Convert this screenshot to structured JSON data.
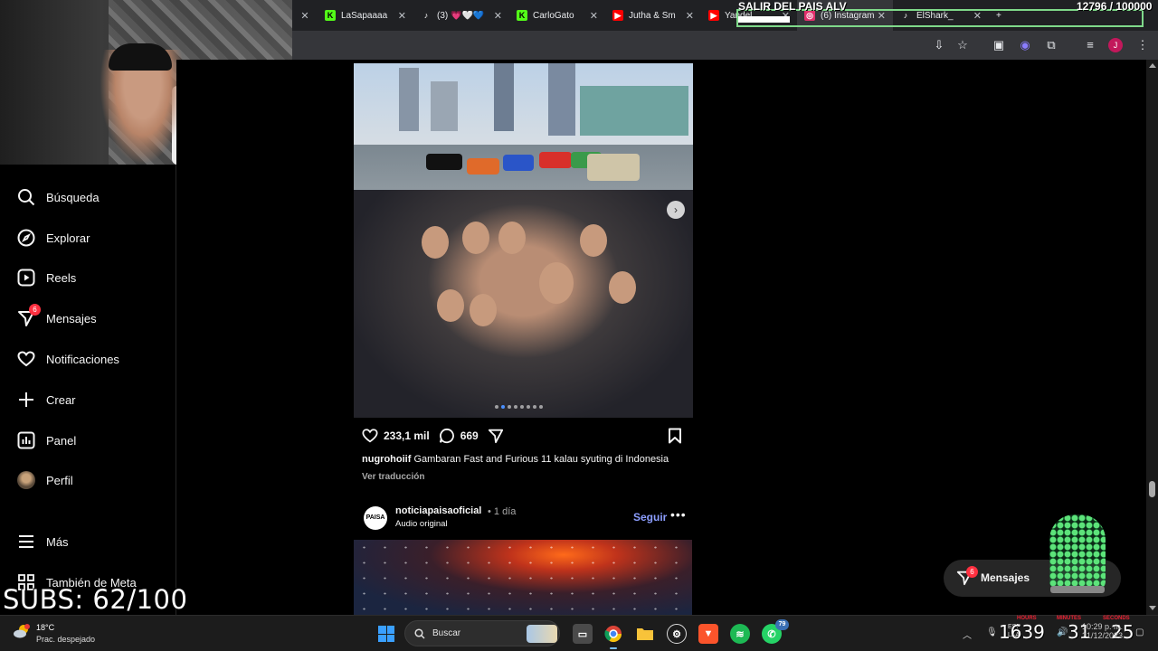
{
  "browser": {
    "tabs": [
      {
        "title": "",
        "color": "#202124",
        "icon": "close-icon"
      },
      {
        "title": "LaSapaaaa",
        "color": "#53fc18",
        "icon": "kick-icon"
      },
      {
        "title": "(3) 💗🤍💙",
        "color": "#ffffff",
        "icon": "tiktok-icon"
      },
      {
        "title": "CarloGato",
        "color": "#53fc18",
        "icon": "kick-icon"
      },
      {
        "title": "Jutha & Sm",
        "color": "#ff0000",
        "icon": "youtube-icon"
      },
      {
        "title": "Yandel",
        "color": "#ff0000",
        "icon": "youtube-icon"
      },
      {
        "title": "(6) Instagram",
        "color": "#e1306c",
        "icon": "instagram-icon"
      },
      {
        "title": "ElShark_",
        "color": "#ffffff",
        "icon": "tiktok-icon"
      }
    ]
  },
  "overlay": {
    "stream_title": "SALIR DEL PAIS ALV",
    "goal_counter": "12796  / 100000",
    "goal_progress": 0.128,
    "subs": "SUBS: 62/100"
  },
  "sidebar": {
    "items": [
      {
        "label": "Búsqueda",
        "icon": "search-icon"
      },
      {
        "label": "Explorar",
        "icon": "compass-icon"
      },
      {
        "label": "Reels",
        "icon": "reels-icon"
      },
      {
        "label": "Mensajes",
        "icon": "messenger-icon",
        "badge": "6"
      },
      {
        "label": "Notificaciones",
        "icon": "heart-icon"
      },
      {
        "label": "Crear",
        "icon": "plus-icon"
      },
      {
        "label": "Panel",
        "icon": "chart-icon"
      },
      {
        "label": "Perfil",
        "icon": "avatar"
      },
      {
        "label": "Más",
        "icon": "menu-icon"
      },
      {
        "label": "También de Meta",
        "icon": "meta-icon"
      }
    ]
  },
  "post1": {
    "likes": "233,1 mil",
    "comments": "669",
    "username": "nugrohoiif",
    "caption": "Gambaran Fast and Furious 11 kalau syuting di Indonesia",
    "translate": "Ver traducción",
    "carousel_count": 8,
    "carousel_active": 1
  },
  "post2": {
    "avatar_text": "PAISA",
    "username": "noticiapaisaoficial",
    "time": "• 1 día",
    "audio": "Audio original",
    "follow": "Seguir",
    "more": "•••"
  },
  "messages_pill": {
    "label": "Mensajes",
    "badge": "6"
  },
  "taskbar": {
    "temperature": "18°C",
    "weather": "Prac. despejado",
    "search": "Buscar",
    "whatsapp_badge": "79",
    "big_clock_h": "1639",
    "big_clock_m": "31",
    "big_clock_s": "25",
    "clock_labels": [
      "HOURS",
      "MINUTES",
      "SECONDS"
    ],
    "time": "10:29 p. m.",
    "date": "21/12/2023",
    "lang": "ESP\nLAA"
  }
}
